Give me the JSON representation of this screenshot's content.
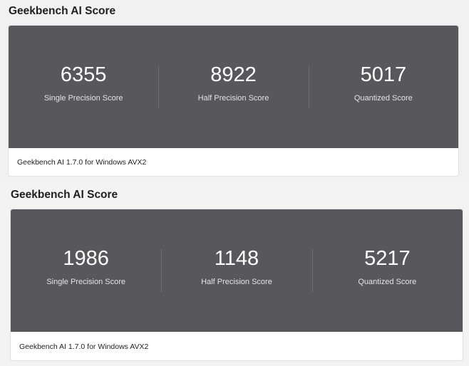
{
  "results": [
    {
      "title": "Geekbench AI Score",
      "scores": [
        {
          "value": "6355",
          "label": "Single Precision Score"
        },
        {
          "value": "8922",
          "label": "Half Precision Score"
        },
        {
          "value": "5017",
          "label": "Quantized Score"
        }
      ],
      "footer": "Geekbench AI 1.7.0 for Windows AVX2"
    },
    {
      "title": "Geekbench AI Score",
      "scores": [
        {
          "value": "1986",
          "label": "Single Precision Score"
        },
        {
          "value": "1148",
          "label": "Half Precision Score"
        },
        {
          "value": "5217",
          "label": "Quantized Score"
        }
      ],
      "footer": "Geekbench AI 1.7.0 for Windows AVX2"
    }
  ]
}
